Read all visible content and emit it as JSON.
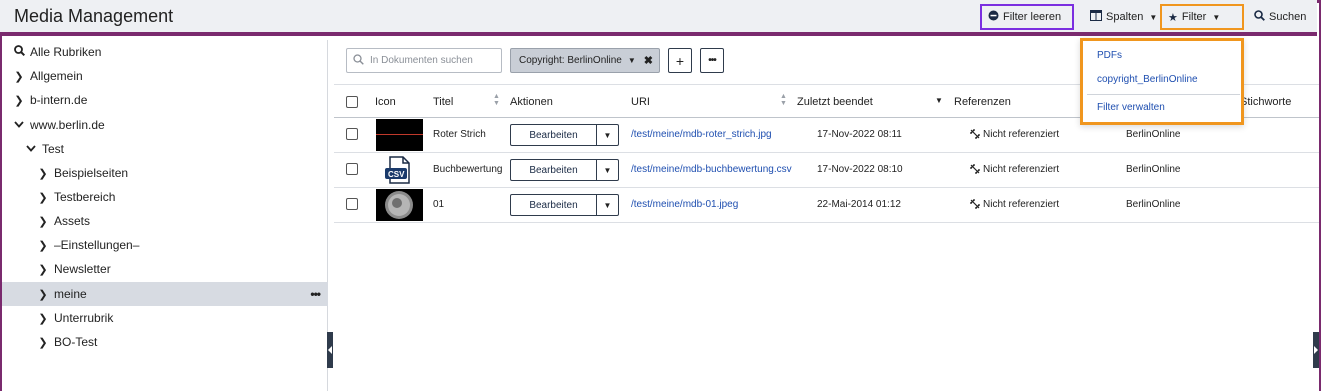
{
  "header": {
    "title": "Media Management",
    "clear_filter": "Filter leeren",
    "columns": "Spalten",
    "filter": "Filter",
    "search": "Suchen"
  },
  "filter_menu": {
    "items": [
      "PDFs",
      "copyright_BerlinOnline",
      "Filter verwalten"
    ]
  },
  "sidebar": {
    "items": [
      {
        "label": "Alle Rubriken",
        "icon": "search-icon"
      },
      {
        "label": "Allgemein",
        "icon": "chevron-right-icon"
      },
      {
        "label": "b-intern.de",
        "icon": "chevron-right-icon"
      },
      {
        "label": "www.berlin.de",
        "icon": "chevron-down-icon"
      },
      {
        "label": "Test",
        "icon": "chevron-down-icon"
      },
      {
        "label": "Beispielseiten",
        "icon": "chevron-right-icon"
      },
      {
        "label": "Testbereich",
        "icon": "chevron-right-icon"
      },
      {
        "label": "Assets",
        "icon": "chevron-right-icon"
      },
      {
        "label": "–Einstellungen–",
        "icon": "chevron-right-icon"
      },
      {
        "label": "Newsletter",
        "icon": "chevron-right-icon"
      },
      {
        "label": "meine",
        "icon": "chevron-right-icon"
      },
      {
        "label": "Unterrubrik",
        "icon": "chevron-right-icon"
      },
      {
        "label": "BO-Test",
        "icon": "chevron-right-icon"
      }
    ]
  },
  "toolbar": {
    "search_placeholder": "In Dokumenten suchen",
    "chip_label": "Copyright: BerlinOnline",
    "add_label": "+",
    "more_label": "•••"
  },
  "table": {
    "columns": {
      "icon": "Icon",
      "title": "Titel",
      "actions": "Aktionen",
      "uri": "URI",
      "finished": "Zuletzt beendet",
      "refs": "Referenzen",
      "keywords": "Stichworte"
    },
    "rows": [
      {
        "title": "Roter Strich",
        "action": "Bearbeiten",
        "uri": "/test/meine/mdb-roter_strich.jpg",
        "finished": "17-Nov-2022 08:11",
        "refs": "Nicht referenziert",
        "owner": "BerlinOnline"
      },
      {
        "title": "Buchbewertung",
        "action": "Bearbeiten",
        "uri": "/test/meine/mdb-buchbewertung.csv",
        "finished": "17-Nov-2022 08:10",
        "refs": "Nicht referenziert",
        "owner": "BerlinOnline"
      },
      {
        "title": "01",
        "action": "Bearbeiten",
        "uri": "/test/meine/mdb-01.jpeg",
        "finished": "22-Mai-2014 01:12",
        "refs": "Nicht referenziert",
        "owner": "BerlinOnline"
      }
    ],
    "csv_label": "CSV"
  },
  "colors": {
    "accent_purple": "#7a2a6e",
    "highlight_violet": "#7b2fe0",
    "highlight_orange": "#f0961e",
    "link_blue": "#1f4fb0"
  }
}
